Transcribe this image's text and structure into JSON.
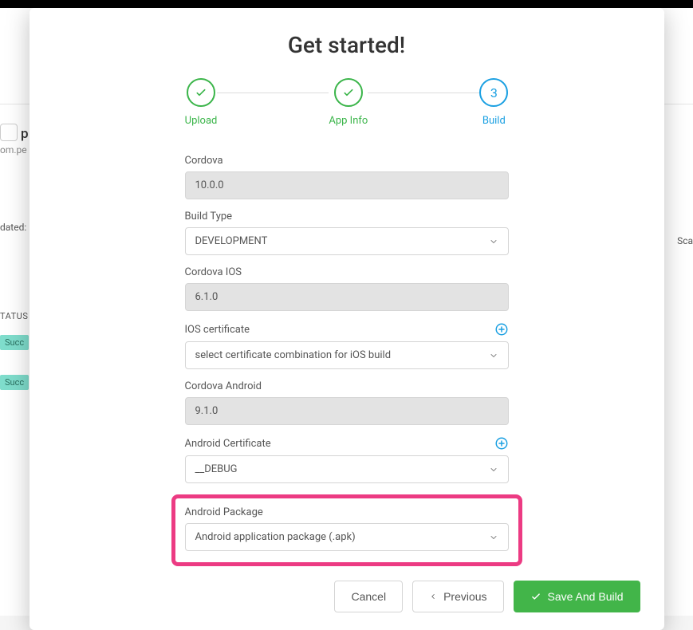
{
  "background": {
    "app_name_partial": "p",
    "app_sub_partial": "om.pe",
    "updated_label": "dated:",
    "sca_label": "Sca",
    "status_label": "TATUS",
    "succ_label": "Succ"
  },
  "modal": {
    "title": "Get started!",
    "stepper": {
      "step1": {
        "label": "Upload"
      },
      "step2": {
        "label": "App Info"
      },
      "step3": {
        "label": "Build",
        "number": "3"
      }
    },
    "form": {
      "cordova": {
        "label": "Cordova",
        "value": "10.0.0"
      },
      "build_type": {
        "label": "Build Type",
        "value": "DEVELOPMENT"
      },
      "cordova_ios": {
        "label": "Cordova IOS",
        "value": "6.1.0"
      },
      "ios_cert": {
        "label": "IOS certificate",
        "value": "select certificate combination for iOS build"
      },
      "cordova_android": {
        "label": "Cordova Android",
        "value": "9.1.0"
      },
      "android_cert": {
        "label": "Android Certificate",
        "value": "__DEBUG"
      },
      "android_package": {
        "label": "Android Package",
        "value": "Android application package (.apk)"
      }
    },
    "footer": {
      "cancel": "Cancel",
      "previous": "Previous",
      "save_build": "Save And Build"
    }
  }
}
